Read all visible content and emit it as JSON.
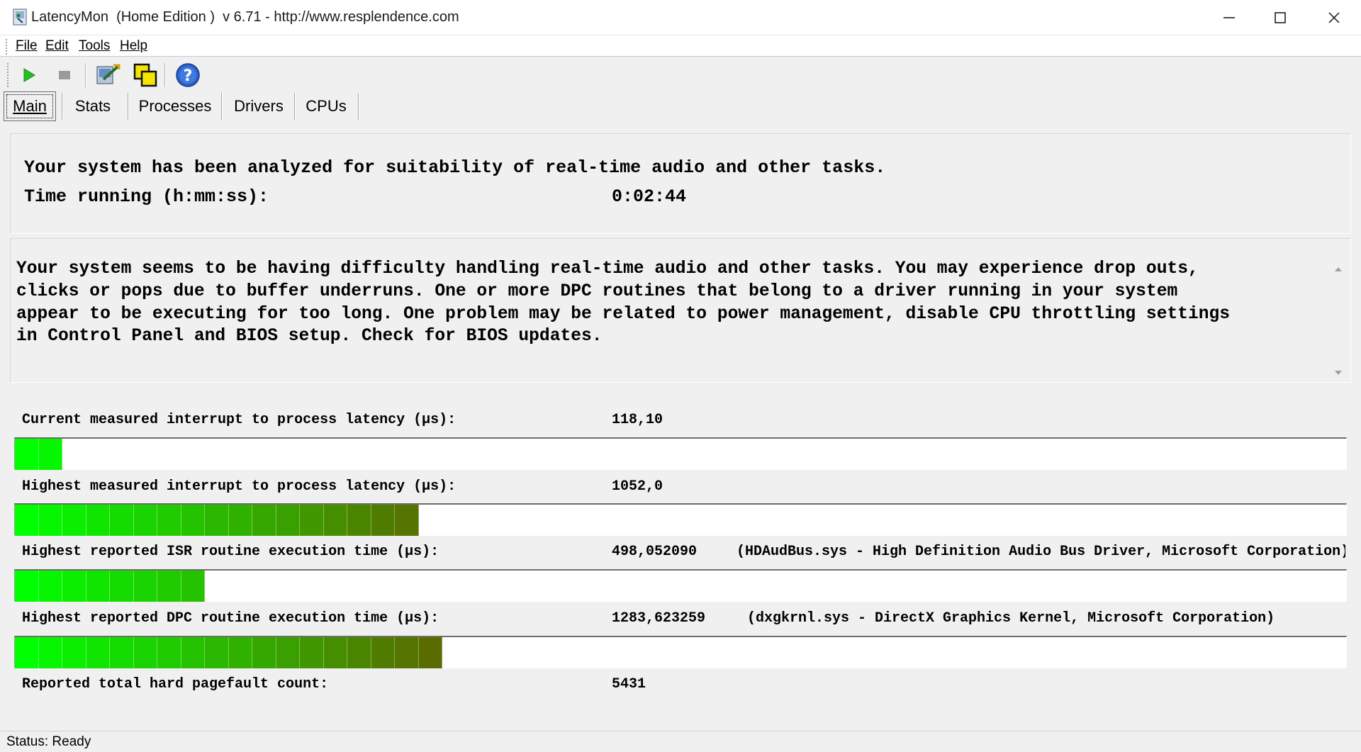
{
  "window": {
    "title": "LatencyMon  (Home Edition )  v 6.71 - http://www.resplendence.com"
  },
  "menu": [
    {
      "label": "File"
    },
    {
      "label": "Edit"
    },
    {
      "label": "Tools"
    },
    {
      "label": "Help"
    }
  ],
  "toolbar": {
    "buttons": [
      "play-icon",
      "stop-icon",
      "wrench-icon",
      "windows-icon",
      "help-icon"
    ]
  },
  "tabs": [
    {
      "label": "Main",
      "active": true
    },
    {
      "label": "Stats",
      "active": false
    },
    {
      "label": "Processes",
      "active": false
    },
    {
      "label": "Drivers",
      "active": false
    },
    {
      "label": "CPUs",
      "active": false
    }
  ],
  "summary": {
    "headline": "Your system has been analyzed for suitability of real-time audio and other tasks.",
    "time_label": "Time running (h:mm:ss):",
    "time_value": "0:02:44"
  },
  "verdict": {
    "text": "Your system seems to be having difficulty handling real-time audio and other tasks. You may experience drop outs,\nclicks or pops due to buffer underruns. One or more DPC routines that belong to a driver running in your system\nappear to be executing for too long. One problem may be related to power management, disable CPU throttling settings\nin Control Panel and BIOS setup. Check for BIOS updates."
  },
  "metrics": [
    {
      "label": "Current measured interrupt to process latency (µs):",
      "value": "118,10",
      "extra": "",
      "bar_segments": 2
    },
    {
      "label": "Highest measured interrupt to process latency (µs):",
      "value": "1052,0",
      "extra": "",
      "bar_segments": 17
    },
    {
      "label": "Highest reported ISR routine execution time (µs):",
      "value": "498,052090",
      "extra": "(HDAudBus.sys - High Definition Audio Bus Driver, Microsoft Corporation)",
      "bar_segments": 8
    },
    {
      "label": "Highest reported DPC routine execution time (µs):",
      "value": "1283,623259",
      "extra": "(dxgkrnl.sys - DirectX Graphics Kernel, Microsoft Corporation)",
      "bar_segments": 18
    },
    {
      "label": "Reported total hard pagefault count:",
      "value": "5431",
      "extra": ""
    }
  ],
  "bar_colors": {
    "start": "#00ff00",
    "end": "#5a6b00"
  },
  "status": {
    "text": "Status: Ready"
  }
}
